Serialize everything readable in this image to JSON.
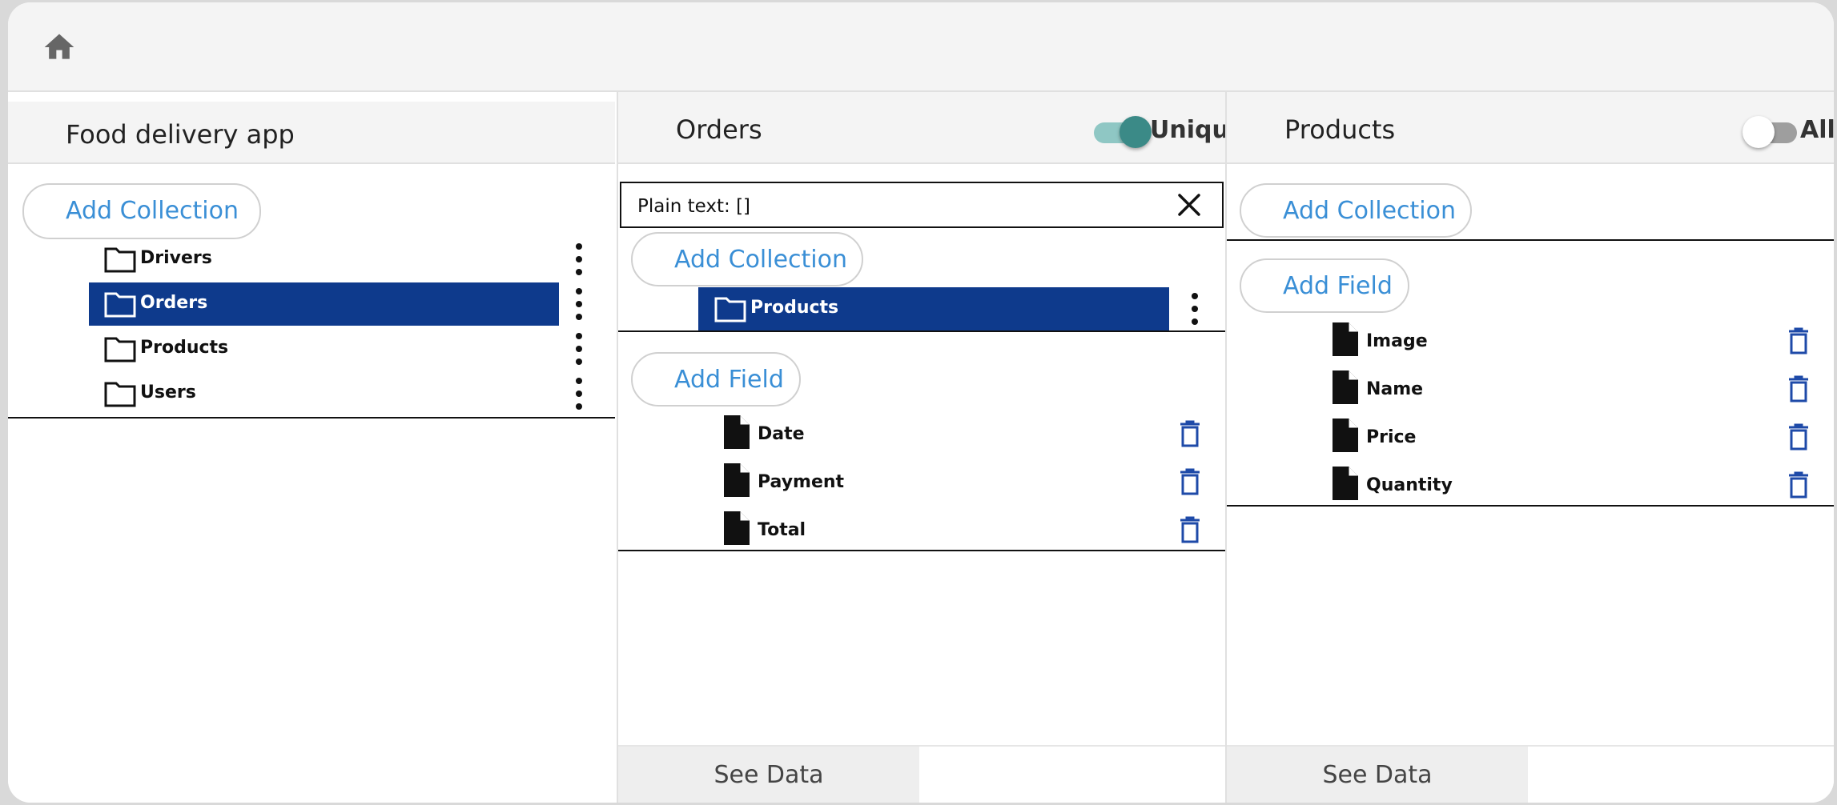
{
  "colors": {
    "accent": "#0e3a8c",
    "link": "#3a8fd6",
    "toggle_on": "#3b8a87"
  },
  "topbar": {
    "home_icon": "home-icon"
  },
  "left_panel": {
    "title": "Food delivery app",
    "add_collection_label": "Add Collection",
    "collections": [
      {
        "label": "Drivers",
        "selected": false
      },
      {
        "label": "Orders",
        "selected": true
      },
      {
        "label": "Products",
        "selected": false
      },
      {
        "label": "Users",
        "selected": false
      }
    ]
  },
  "middle_panel": {
    "title": "Orders",
    "toggle": {
      "label": "Unique",
      "on": true
    },
    "search_text": "Plain text: []",
    "add_collection_label": "Add Collection",
    "collections": [
      {
        "label": "Products",
        "selected": true
      }
    ],
    "add_field_label": "Add Field",
    "fields": [
      {
        "label": "Date"
      },
      {
        "label": "Payment"
      },
      {
        "label": "Total"
      }
    ],
    "see_data_label": "See Data"
  },
  "right_panel": {
    "title": "Products",
    "toggle": {
      "label": "All",
      "on": false
    },
    "add_collection_label": "Add Collection",
    "add_field_label": "Add Field",
    "fields": [
      {
        "label": "Image"
      },
      {
        "label": "Name"
      },
      {
        "label": "Price"
      },
      {
        "label": "Quantity"
      }
    ],
    "see_data_label": "See Data"
  }
}
